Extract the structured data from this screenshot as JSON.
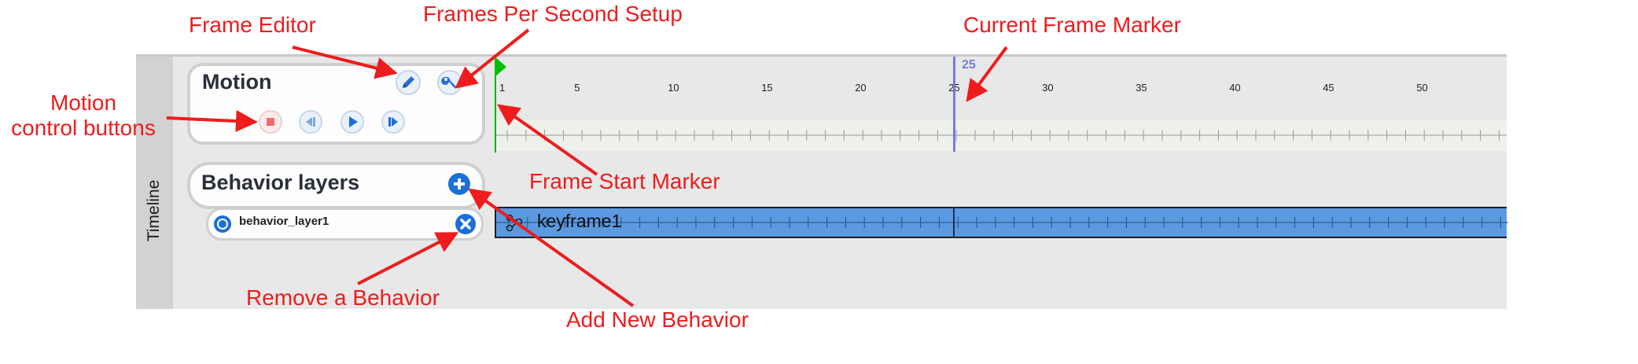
{
  "timeline": {
    "vertical_label": "Timeline",
    "motion": {
      "title": "Motion"
    },
    "behavior": {
      "title": "Behavior layers",
      "layers": [
        {
          "name": "behavior_layer1"
        }
      ]
    },
    "ruler": {
      "labels": [
        "1",
        "5",
        "10",
        "15",
        "20",
        "25",
        "30",
        "35",
        "40",
        "45",
        "50"
      ],
      "current_frame": "25"
    },
    "keyframe": {
      "label": "keyframe1"
    }
  },
  "icons": {
    "frame_editor": "pencil-icon",
    "fps_setup": "wrench-icon",
    "stop": "stop-icon",
    "step_back": "step-back-icon",
    "play": "play-icon",
    "step_forward": "step-forward-icon",
    "add_behavior": "plus-icon",
    "remove_behavior": "close-icon",
    "layer_radio": "radio-icon",
    "keyframe": "keyframe-icon"
  },
  "colors": {
    "annotation": "#ee1c1c",
    "keyframe_bar": "#5b9ae0",
    "current_marker": "#7878ee",
    "start_marker": "#00b400",
    "icon_blue": "#1a6fd8"
  },
  "annotations": {
    "frame_editor": "Frame Editor",
    "fps_setup": "Frames Per Second Setup",
    "current_frame_marker": "Current Frame Marker",
    "motion_buttons_line1": "Motion",
    "motion_buttons_line2": "control buttons",
    "frame_start_marker": "Frame Start Marker",
    "remove_behavior": "Remove a Behavior",
    "add_behavior": "Add New Behavior"
  }
}
